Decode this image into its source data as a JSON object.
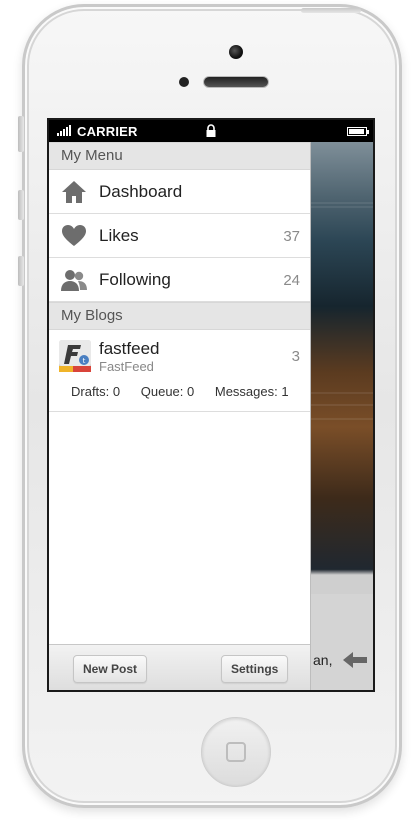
{
  "status_bar": {
    "carrier": "CARRIER"
  },
  "menu": {
    "section_title": "My Menu",
    "items": [
      {
        "label": "Dashboard",
        "icon": "home-icon",
        "count": ""
      },
      {
        "label": "Likes",
        "icon": "heart-icon",
        "count": "37"
      },
      {
        "label": "Following",
        "icon": "people-icon",
        "count": "24"
      }
    ]
  },
  "blogs": {
    "section_title": "My Blogs",
    "items": [
      {
        "name": "fastfeed",
        "subtitle": "FastFeed",
        "count": "3",
        "avatar_icon": "fastfeed-logo-icon",
        "stats": {
          "drafts": "Drafts: 0",
          "queue": "Queue: 0",
          "messages": "Messages: 1"
        }
      }
    ]
  },
  "toolbar": {
    "new_post": "New Post",
    "settings": "Settings"
  },
  "background": {
    "snippet": "an,"
  },
  "colors": {
    "icon_gray": "#6d6d6d",
    "section_bg": "#e5e5e5"
  }
}
